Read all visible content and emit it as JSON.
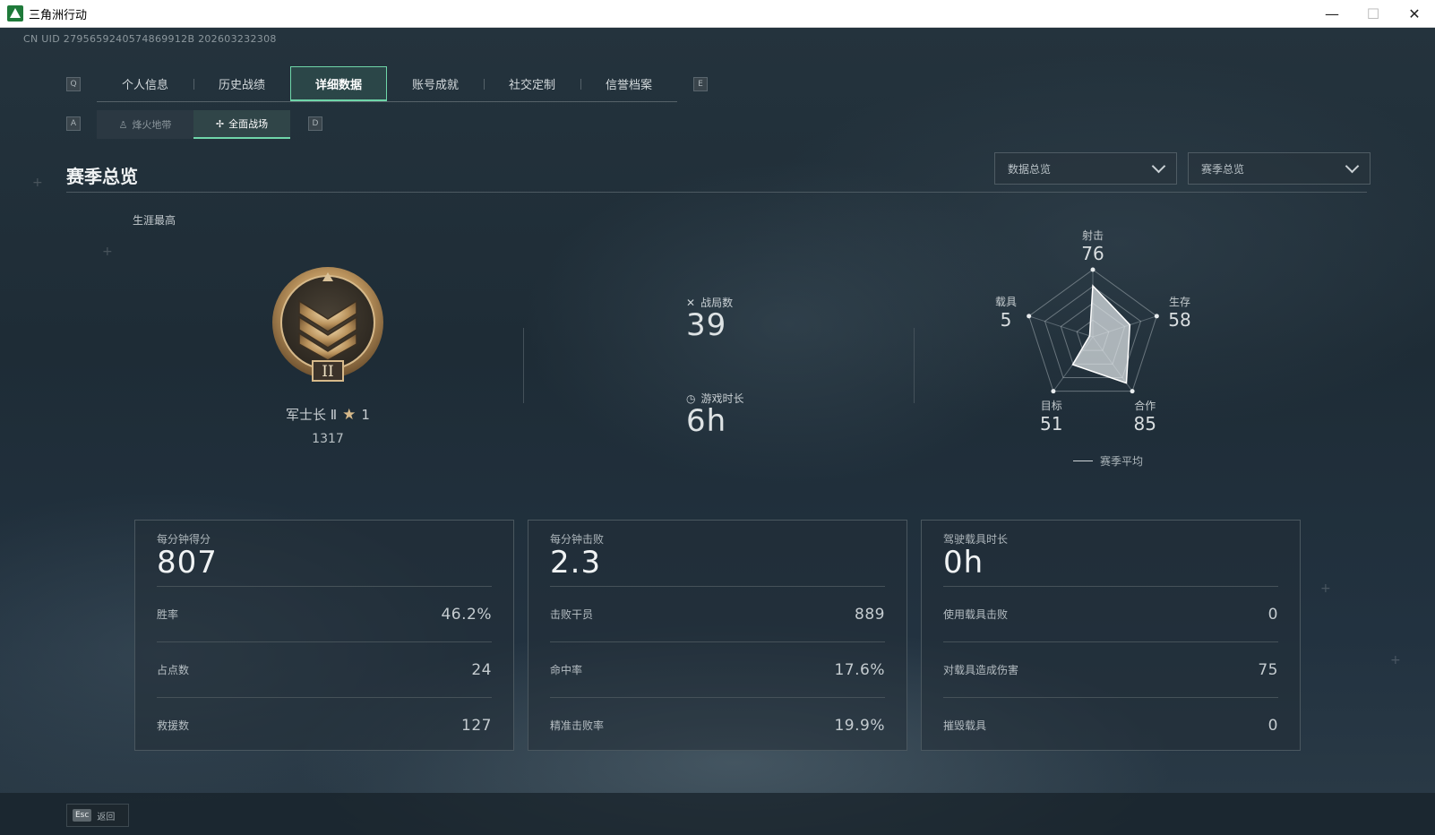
{
  "window": {
    "title": "三角洲行动",
    "minimize": "—",
    "maximize": "☐",
    "close": "✕"
  },
  "uid": "CN UID 2795659240574869912B 202603232308",
  "key_hints": {
    "tab_prev": "Q",
    "tab_next": "E",
    "sub_prev": "A",
    "sub_next": "D"
  },
  "tabs": [
    {
      "label": "个人信息",
      "active": false
    },
    {
      "label": "历史战绩",
      "active": false
    },
    {
      "label": "详细数据",
      "active": true
    },
    {
      "label": "账号成就",
      "active": false
    },
    {
      "label": "社交定制",
      "active": false
    },
    {
      "label": "信誉档案",
      "active": false
    }
  ],
  "subtabs": [
    {
      "label": "烽火地带",
      "icon": "helmet-icon",
      "active": false
    },
    {
      "label": "全面战场",
      "icon": "arrows-icon",
      "active": true
    }
  ],
  "section_title": "赛季总览",
  "dropdowns": {
    "data_overview": "数据总览",
    "season_overview": "赛季总览"
  },
  "career": {
    "label": "生涯最高",
    "rank_name": "军士长 Ⅱ",
    "stars": "1",
    "score": "1317",
    "rank_numeral": "II"
  },
  "match_stats": {
    "matches_label": "战局数",
    "matches_value": "39",
    "playtime_label": "游戏时长",
    "playtime_value": "6h"
  },
  "radar": {
    "axes": [
      {
        "label": "射击",
        "value": "76"
      },
      {
        "label": "生存",
        "value": "58"
      },
      {
        "label": "合作",
        "value": "85"
      },
      {
        "label": "目标",
        "value": "51"
      },
      {
        "label": "载具",
        "value": "5"
      }
    ],
    "values": [
      76,
      58,
      85,
      51,
      5
    ],
    "max": 100,
    "legend": "赛季平均"
  },
  "cards": [
    {
      "head_label": "每分钟得分",
      "head_value": "807",
      "rows": [
        {
          "label": "胜率",
          "value": "46.2%"
        },
        {
          "label": "占点数",
          "value": "24"
        },
        {
          "label": "救援数",
          "value": "127"
        }
      ]
    },
    {
      "head_label": "每分钟击败",
      "head_value": "2.3",
      "rows": [
        {
          "label": "击败干员",
          "value": "889"
        },
        {
          "label": "命中率",
          "value": "17.6%"
        },
        {
          "label": "精准击败率",
          "value": "19.9%"
        }
      ]
    },
    {
      "head_label": "驾驶载具时长",
      "head_value": "0h",
      "rows": [
        {
          "label": "使用载具击败",
          "value": "0"
        },
        {
          "label": "对载具造成伤害",
          "value": "75"
        },
        {
          "label": "摧毁载具",
          "value": "0"
        }
      ]
    }
  ],
  "footer": {
    "esc_key": "Esc",
    "esc_label": "返回"
  },
  "colors": {
    "accent": "#6fd6a9",
    "background": "#1e2c36",
    "card_border": "#4a575f"
  }
}
